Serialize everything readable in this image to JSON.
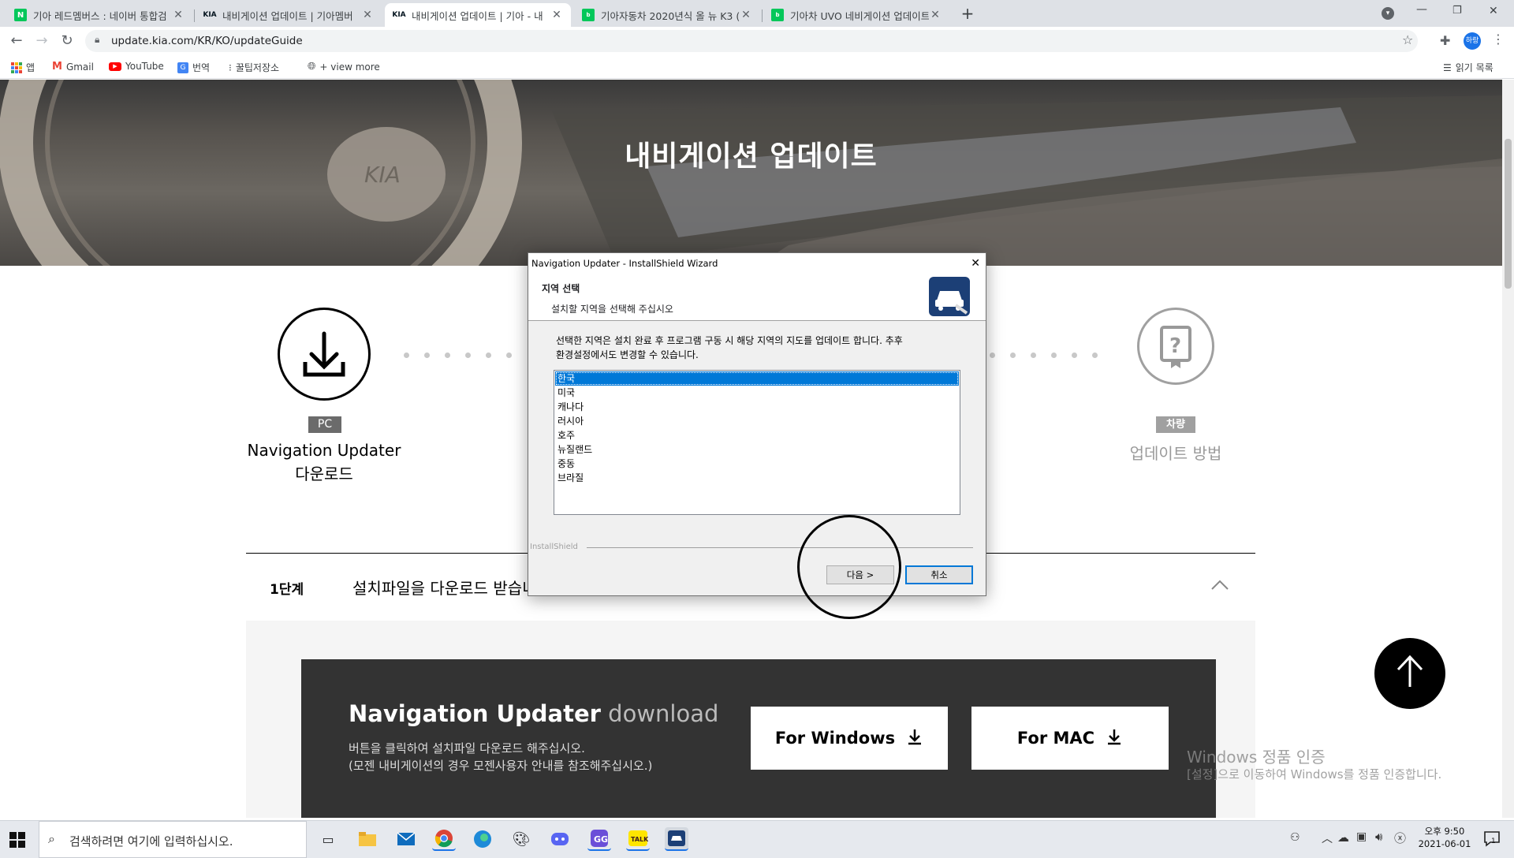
{
  "browser": {
    "tabs": [
      {
        "title": "기아 레드멤버스 : 네이버 통합검",
        "favicon": "naver-n-icon",
        "active": false
      },
      {
        "title": "내비게이션 업데이트 | 기아멤버",
        "favicon": "kia-logo-icon",
        "active": false
      },
      {
        "title": "내비게이션 업데이트 | 기아 - 내",
        "favicon": "kia-logo-icon",
        "active": true
      },
      {
        "title": "기아자동차 2020년식 올 뉴 K3 (",
        "favicon": "naver-blog-icon",
        "active": false
      },
      {
        "title": "기아차 UVO 네비게이션 업데이트",
        "favicon": "naver-blog-icon",
        "active": false
      }
    ],
    "url": "update.kia.com/KR/KO/updateGuide",
    "profile": "하랑",
    "bookmarks": [
      "앱",
      "Gmail",
      "YouTube",
      "번역",
      "꿀팁저장소",
      "+ view more"
    ],
    "reading_list": "읽기 목록"
  },
  "page": {
    "hero_title": "내비게이션 업데이트",
    "step1_badge": "PC",
    "step1_line1": "Navigation Updater",
    "step1_line2": "다운로드",
    "step4_badge": "차량",
    "step4_label": "업데이트 방법",
    "section_step": "1단계",
    "section_title": "설치파일을 다운로드 받습니다",
    "download_title_bold": "Navigation Updater",
    "download_title_light": " download",
    "download_desc1": "버튼을 클릭하여 설치파일 다운로드 해주십시오.",
    "download_desc2": "(모젠 내비게이션의 경우 모젠사용자 안내를 참조해주십시오.)",
    "btn_windows": "For Windows",
    "btn_mac": "For MAC",
    "activation_title": "Windows 정품 인증",
    "activation_desc": "[설정]으로 이동하여 Windows를 정품 인증합니다."
  },
  "dialog": {
    "title": "Navigation Updater - InstallShield Wizard",
    "heading": "지역 선택",
    "subheading": "설치할 지역을 선택해 주십시오",
    "description_line1": "선택한 지역은 설치 완료 후 프로그램 구동 시 해당 지역의 지도를 업데이트 합니다. 추후",
    "description_line2": "환경설정에서도 변경할 수 있습니다.",
    "regions": [
      "한국",
      "미국",
      "캐나다",
      "러시아",
      "호주",
      "뉴질랜드",
      "중동",
      "브라질"
    ],
    "selected_index": 0,
    "brand": "InstallShield",
    "next_button": "다음 >",
    "cancel_button": "취소"
  },
  "taskbar": {
    "search_placeholder": "검색하려면 여기에 입력하십시오.",
    "time": "오후 9:50",
    "date": "2021-06-01",
    "notification_count": "1"
  }
}
